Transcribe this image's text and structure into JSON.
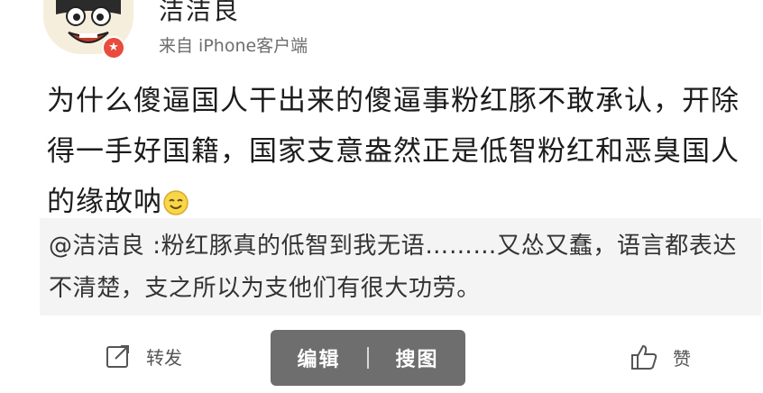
{
  "user": {
    "name": "洁洁良",
    "source": "来自 iPhone客户端"
  },
  "post": {
    "text": "为什么傻逼国人干出来的傻逼事粉红豚不敢承认，开除得一手好国籍，国家支意盎然正是低智粉红和恶臭国人的缘故呐",
    "emoji_icon": "smile-emoji-icon"
  },
  "quoted_comment": {
    "text": "@洁洁良 :粉红豚真的低智到我无语………又怂又蠢，语言都表达不清楚，支之所以为支他们有很大功劳。"
  },
  "actions": {
    "repost_label": "转发",
    "like_label": "赞",
    "repost_icon": "share-icon",
    "like_icon": "thumbs-up-icon"
  },
  "popup_menu": {
    "edit_label": "编辑",
    "search_image_label": "搜图"
  },
  "colors": {
    "badge": "#e94b3c",
    "quote_bg": "#f4f4f4",
    "popup_bg": "#6e6e6e"
  }
}
